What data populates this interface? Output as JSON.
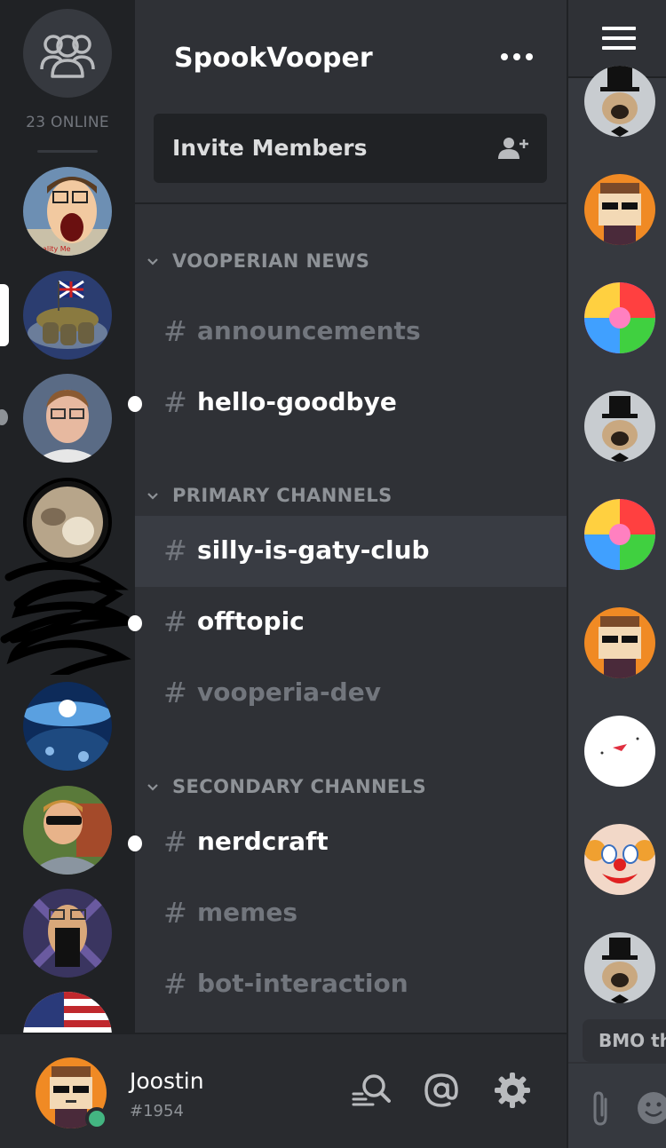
{
  "rail": {
    "online_count": "23 ONLINE"
  },
  "server": {
    "name": "SpookVooper",
    "invite_label": "Invite Members"
  },
  "categories": [
    {
      "label": "VOOPERIAN NEWS"
    },
    {
      "label": "PRIMARY CHANNELS"
    },
    {
      "label": "SECONDARY CHANNELS"
    }
  ],
  "channels": [
    {
      "hash": "#",
      "name": "announcements"
    },
    {
      "hash": "#",
      "name": "hello-goodbye"
    },
    {
      "hash": "#",
      "name": "silly-is-gaty-club"
    },
    {
      "hash": "#",
      "name": "offtopic"
    },
    {
      "hash": "#",
      "name": "vooperia-dev"
    },
    {
      "hash": "#",
      "name": "nerdcraft"
    },
    {
      "hash": "#",
      "name": "memes"
    },
    {
      "hash": "#",
      "name": "bot-interaction"
    }
  ],
  "user": {
    "name": "Joostin",
    "discriminator": "#1954"
  },
  "members": {
    "message_snippet": "BMO th"
  },
  "colors": {
    "rail_bg": "#202225",
    "channels_bg": "#2f3136",
    "active_channel_bg": "#393c43",
    "online_status": "#43b581",
    "muted_text": "#72767d"
  }
}
